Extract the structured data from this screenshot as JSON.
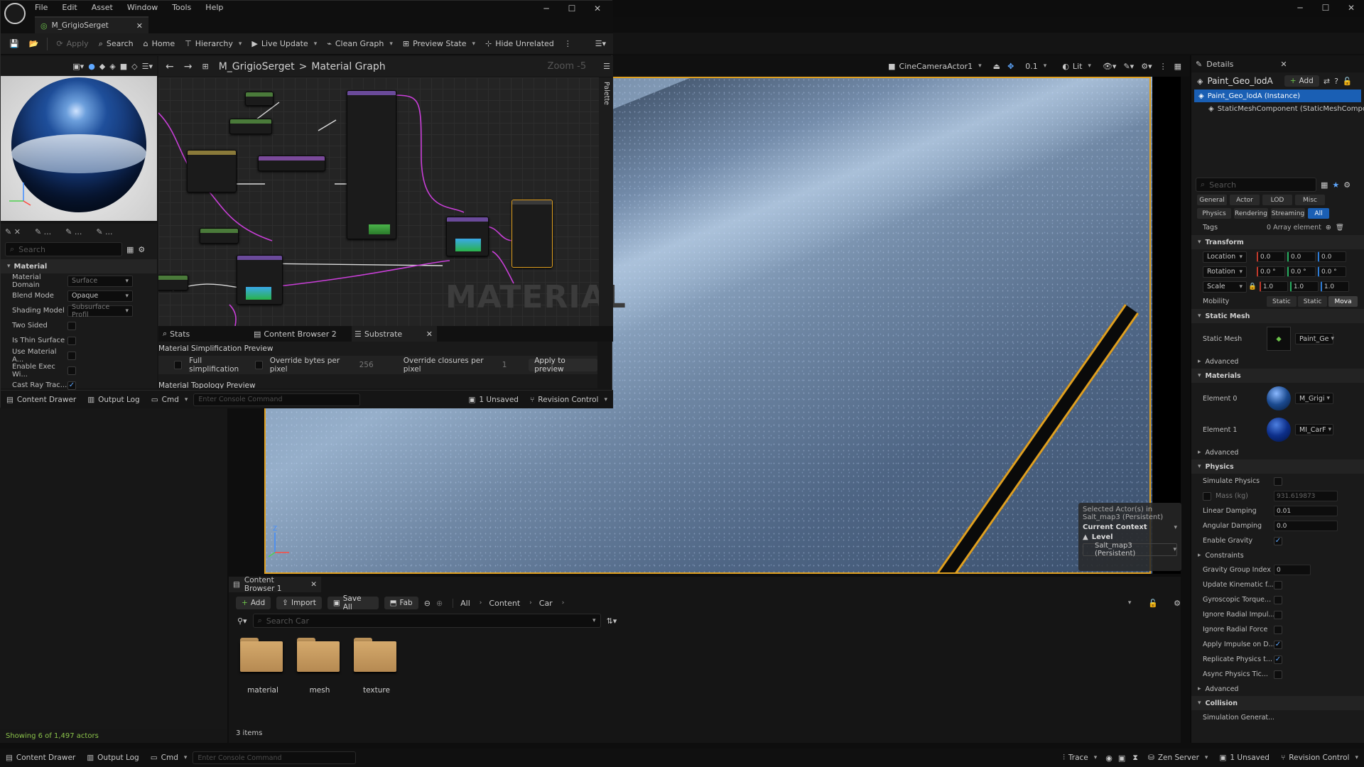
{
  "main_menu": [
    "File",
    "Edit",
    "Asset",
    "Window",
    "Tools",
    "Help"
  ],
  "mat_doc_tab": "M_GrigioSerget",
  "mat_toolbar": {
    "apply": "Apply",
    "search": "Search",
    "home": "Home",
    "hierarchy": "Hierarchy",
    "live_update": "Live Update",
    "clean_graph": "Clean Graph",
    "preview_state": "Preview State",
    "hide_unrelated": "Hide Unrelated"
  },
  "graph": {
    "path_root": "M_GrigioSerget",
    "path_sep": ">",
    "path_leaf": "Material Graph",
    "zoom": "Zoom -5",
    "watermark": "MATERIAL",
    "palette": "Palette"
  },
  "mat_details": {
    "search_placeholder": "Search",
    "section": "Material",
    "rows": [
      {
        "label": "Material Domain",
        "value": "Surface"
      },
      {
        "label": "Blend Mode",
        "value": "Opaque"
      },
      {
        "label": "Shading Model",
        "value": "Subsurface Profil"
      },
      {
        "label": "Two Sided",
        "value": ""
      },
      {
        "label": "Is Thin Surface",
        "value": ""
      },
      {
        "label": "Use Material A...",
        "value": ""
      },
      {
        "label": "Enable Exec Wi...",
        "value": ""
      },
      {
        "label": "Cast Ray Trac...",
        "value": ""
      }
    ]
  },
  "mat_bottom_tabs": {
    "stats": "Stats",
    "cb2": "Content Browser 2",
    "substrate": "Substrate"
  },
  "simplification": {
    "title": "Material Simplification Preview",
    "full": "Full simplification",
    "override_bytes": "Override bytes per pixel",
    "bytes_value": "256",
    "override_closures": "Override closures per pixel",
    "closures_value": "1",
    "apply": "Apply to preview",
    "next_title": "Material Topology Preview"
  },
  "mat_status": {
    "content_drawer": "Content Drawer",
    "output_log": "Output Log",
    "cmd": "Cmd",
    "console_placeholder": "Enter Console Command",
    "unsaved": "1 Unsaved",
    "revision": "Revision Control"
  },
  "viewport_tb": {
    "camera": "CineCameraActor1",
    "scale": "0.1",
    "lit": "Lit"
  },
  "context": {
    "line1": "Selected Actor(s) in",
    "line2": "Salt_map3 (Persistent)",
    "current": "Current Context",
    "level": "Level",
    "level_value": "Salt_map3 (Persistent)"
  },
  "details": {
    "tab": "Details",
    "actor": "Paint_Geo_lodA",
    "add": "Add",
    "instance": "Paint_Geo_lodA (Instance)",
    "component": "StaticMeshComponent (StaticMeshComponent)",
    "search_placeholder": "Search",
    "filters_row1": [
      "General",
      "Actor",
      "LOD",
      "Misc"
    ],
    "filters_row2": [
      "Physics",
      "Rendering",
      "Streaming",
      "All"
    ],
    "tags_label": "Tags",
    "tags_value": "0 Array element",
    "transform": "Transform",
    "location": "Location",
    "rotation": "Rotation",
    "scale": "Scale",
    "loc_vals": [
      "0.0",
      "0.0",
      "0.0"
    ],
    "rot_vals": [
      "0.0 °",
      "0.0 °",
      "0.0 °"
    ],
    "scale_vals": [
      "1.0",
      "1.0",
      "1.0"
    ],
    "mobility": "Mobility",
    "mobility_opts": [
      "Static",
      "Static",
      "Mova"
    ],
    "static_mesh_sect": "Static Mesh",
    "static_mesh_label": "Static Mesh",
    "static_mesh_value": "Paint_Ge",
    "advanced": "Advanced",
    "materials": "Materials",
    "element0": "Element 0",
    "element0_value": "M_Grigi",
    "element1": "Element 1",
    "element1_value": "MI_CarF",
    "physics": "Physics",
    "simulate": "Simulate Physics",
    "mass": "Mass (kg)",
    "mass_value": "931.619873",
    "linear": "Linear Damping",
    "linear_value": "0.01",
    "angular": "Angular Damping",
    "angular_value": "0.0",
    "gravity": "Enable Gravity",
    "constraints": "Constraints",
    "gravity_group": "Gravity Group Index",
    "gravity_group_value": "0",
    "update_kin": "Update Kinematic f...",
    "gyro": "Gyroscopic Torque...",
    "ignore_radial_imp": "Ignore Radial Impul...",
    "ignore_radial_force": "Ignore Radial Force",
    "apply_impulse": "Apply Impulse on D...",
    "replicate": "Replicate Physics t...",
    "async": "Async Physics Tic...",
    "collision": "Collision",
    "sim_gen": "Simulation Generat..."
  },
  "outliner": {
    "showing": "Showing 6 of 1,497 actors"
  },
  "content_browser": {
    "tab": "Content Browser 1",
    "add": "Add",
    "import": "Import",
    "save_all": "Save All",
    "fab": "Fab",
    "path": [
      "All",
      "Content",
      "Car"
    ],
    "search_placeholder": "Search Car",
    "folders": [
      "material",
      "mesh",
      "texture"
    ],
    "count": "3 items"
  },
  "statusbar": {
    "content_drawer": "Content Drawer",
    "output_log": "Output Log",
    "cmd": "Cmd",
    "console_placeholder": "Enter Console Command",
    "trace": "Trace",
    "zen": "Zen Server",
    "unsaved": "1 Unsaved",
    "revision": "Revision Control"
  },
  "colors": {
    "accent": "#e0a020",
    "selection": "#1a5fb4",
    "ok": "#8bc34a",
    "pin_purple": "#c93fd8"
  }
}
